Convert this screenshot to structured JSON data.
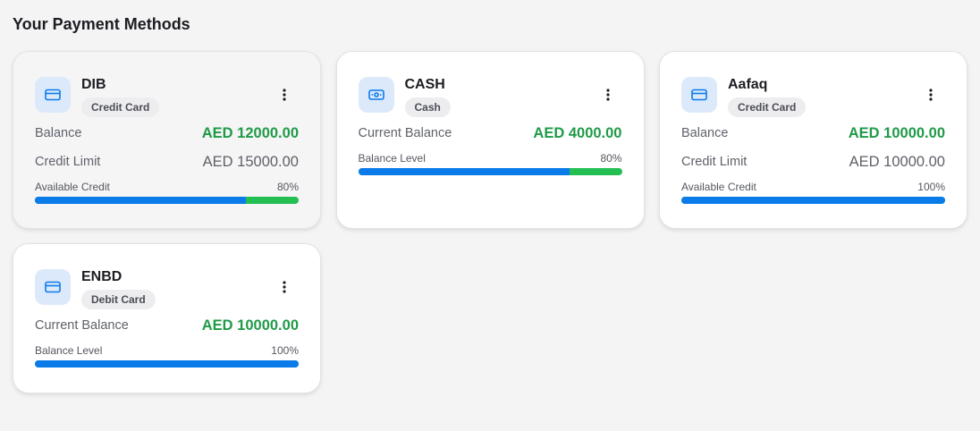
{
  "page": {
    "title": "Your Payment Methods"
  },
  "colors": {
    "accent_blue": "#0b7bea",
    "positive_green": "#1f9a47",
    "bar_remainder_green": "#23bf53",
    "icon_bg": "#dce9fb"
  },
  "cards": [
    {
      "name": "DIB",
      "type": "Credit Card",
      "icon": "credit-card-icon",
      "rows": [
        {
          "label": "Balance",
          "value": "AED 12000.00",
          "style": "green"
        },
        {
          "label": "Credit Limit",
          "value": "AED 15000.00",
          "style": "gray"
        }
      ],
      "bar": {
        "label": "Available Credit",
        "percent_text": "80%",
        "level": 0.8
      }
    },
    {
      "name": "CASH",
      "type": "Cash",
      "icon": "cash-icon",
      "rows": [
        {
          "label": "Current Balance",
          "value": "AED 4000.00",
          "style": "green"
        }
      ],
      "bar": {
        "label": "Balance Level",
        "percent_text": "80%",
        "level": 0.8
      }
    },
    {
      "name": "Aafaq",
      "type": "Credit Card",
      "icon": "credit-card-icon",
      "rows": [
        {
          "label": "Balance",
          "value": "AED 10000.00",
          "style": "green"
        },
        {
          "label": "Credit Limit",
          "value": "AED 10000.00",
          "style": "gray"
        }
      ],
      "bar": {
        "label": "Available Credit",
        "percent_text": "100%",
        "level": 1.0
      }
    },
    {
      "name": "ENBD",
      "type": "Debit Card",
      "icon": "credit-card-icon",
      "rows": [
        {
          "label": "Current Balance",
          "value": "AED 10000.00",
          "style": "green"
        }
      ],
      "bar": {
        "label": "Balance Level",
        "percent_text": "100%",
        "level": 1.0
      }
    }
  ]
}
